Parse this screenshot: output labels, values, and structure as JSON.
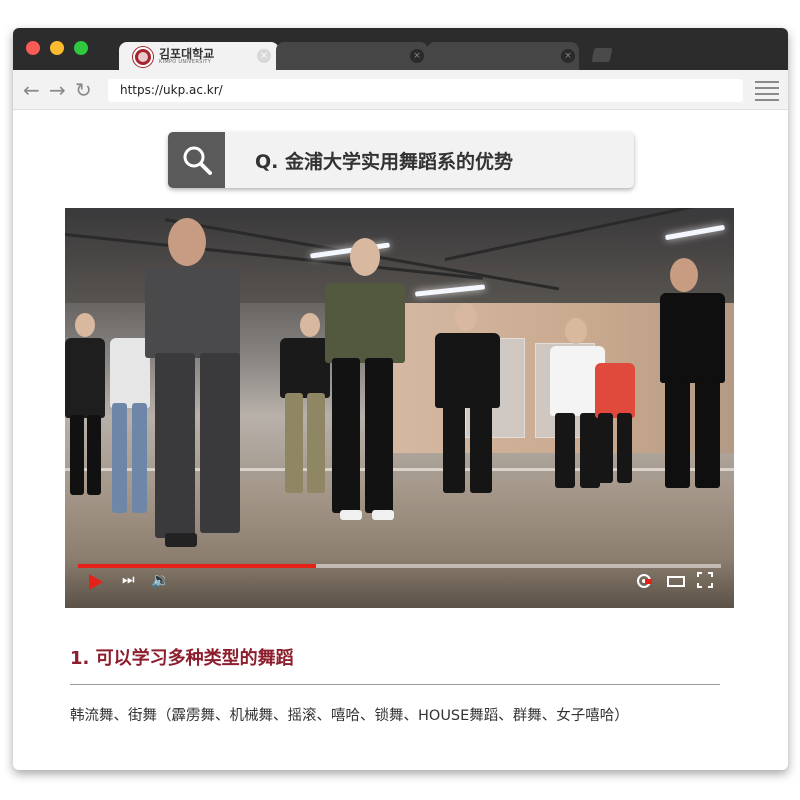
{
  "browser": {
    "active_tab": {
      "title": "김포대학교",
      "subtitle": "KIMPO UNIVERSITY",
      "close_label": "×"
    },
    "inactive_tab_close_label": "×",
    "nav": {
      "back_icon": "←",
      "forward_icon": "→",
      "reload_icon": "↻"
    },
    "address": "https://ukp.ac.kr/"
  },
  "search": {
    "query": "Q. 金浦大学实用舞蹈系的优势"
  },
  "video": {
    "progress": 0.37,
    "next_icon": "⏭",
    "volume_icon": "🔉",
    "colors": {
      "progress": "#e62117",
      "play": "#e62117"
    }
  },
  "content": {
    "section_title": "1. 可以学习多种类型的舞蹈",
    "section_description": "韩流舞、街舞（霹雳舞、机械舞、摇滚、嘻哈、锁舞、HOUSE舞蹈、群舞、女子嘻哈）"
  },
  "colors": {
    "accent": "#8c1e2d",
    "logo": "#a4242f"
  }
}
